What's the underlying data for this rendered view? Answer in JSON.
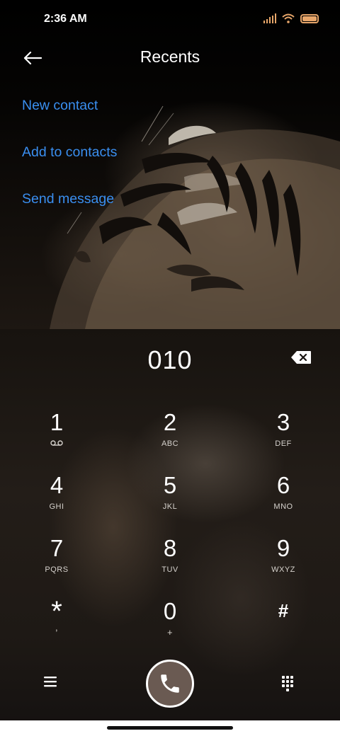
{
  "status_bar": {
    "time": "2:36 AM",
    "icons": [
      "signal-icon",
      "wifi-icon",
      "battery-icon"
    ],
    "accent_color": "#e8a66a"
  },
  "header": {
    "title": "Recents",
    "back_icon": "arrow-left-icon"
  },
  "actions": {
    "new_contact": "New contact",
    "add_to_contacts": "Add to contacts",
    "send_message": "Send message",
    "link_color": "#3a8ff0"
  },
  "dialer": {
    "number": "010",
    "backspace_icon": "backspace-icon",
    "keys": [
      {
        "digit": "1",
        "letters": "",
        "sub_icon": "voicemail-icon"
      },
      {
        "digit": "2",
        "letters": "ABC"
      },
      {
        "digit": "3",
        "letters": "DEF"
      },
      {
        "digit": "4",
        "letters": "GHI"
      },
      {
        "digit": "5",
        "letters": "JKL"
      },
      {
        "digit": "6",
        "letters": "MNO"
      },
      {
        "digit": "7",
        "letters": "PQRS"
      },
      {
        "digit": "8",
        "letters": "TUV"
      },
      {
        "digit": "9",
        "letters": "WXYZ"
      },
      {
        "digit": "*",
        "letters": ","
      },
      {
        "digit": "0",
        "letters": "+"
      },
      {
        "digit": "#",
        "letters": ""
      }
    ]
  },
  "bottom_bar": {
    "menu_icon": "hamburger-menu-icon",
    "call_icon": "phone-icon",
    "call_button_color": "#6a5a52",
    "dialpad_icon": "dialpad-icon"
  }
}
